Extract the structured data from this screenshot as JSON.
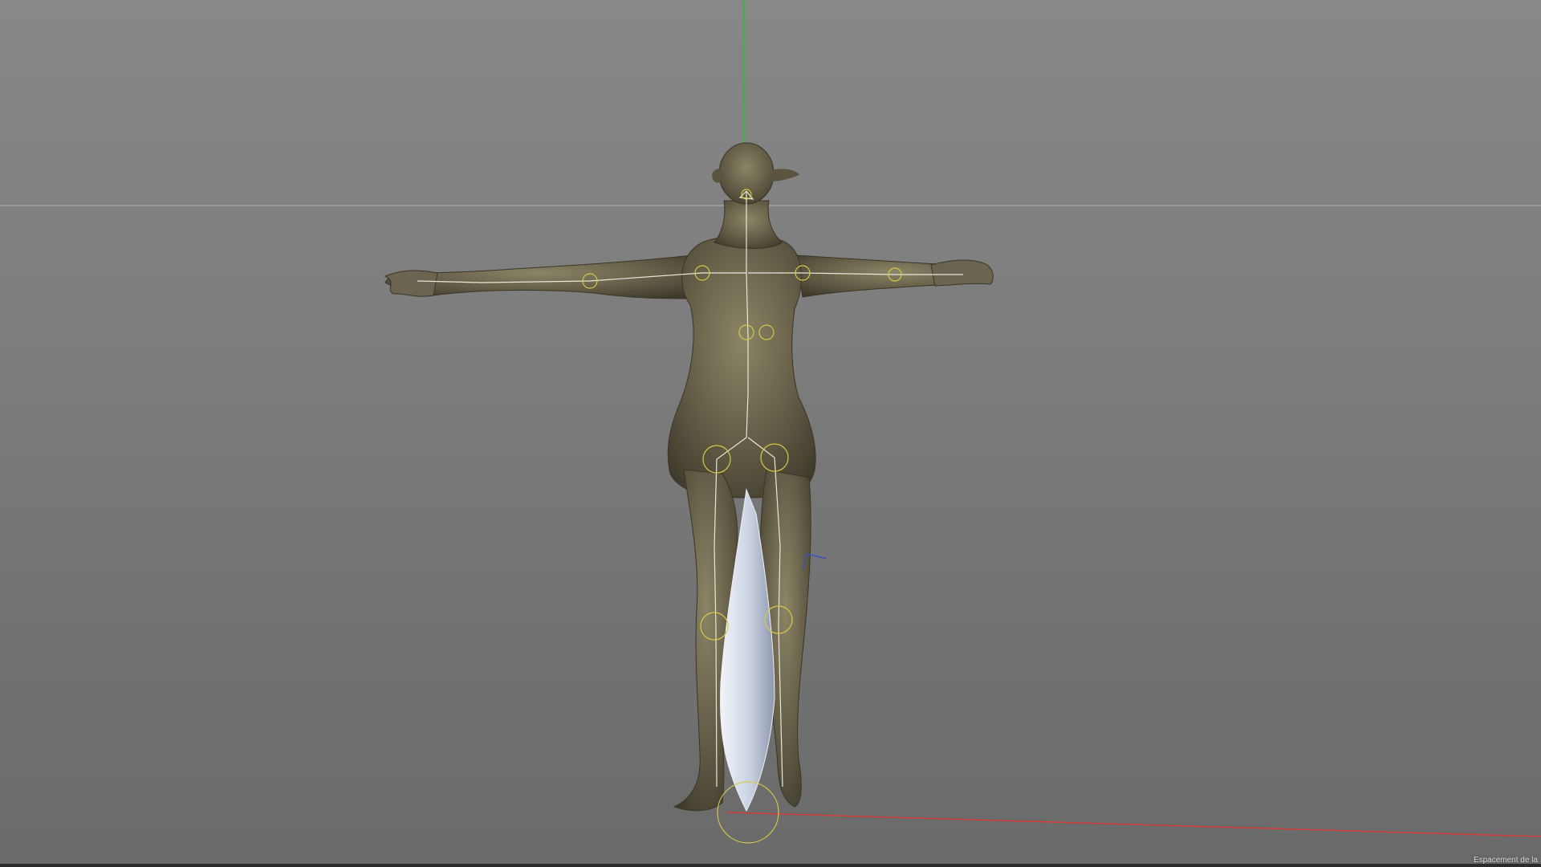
{
  "viewport": {
    "status_text": "Espacement de la",
    "colors": {
      "background_top": "#888888",
      "background_bottom": "#6a6a6a",
      "y_axis": "#2fbf2f",
      "x_axis": "#d23a3a",
      "horizon_line": "#a8a8a8",
      "skin": "#5f5a45",
      "skin_highlight": "#8a8566",
      "bone": "#e8e8d8",
      "joint": "#d8c84a",
      "blade": "#cfd6e6"
    },
    "icons": {
      "model": "character-mesh-icon",
      "skeleton": "joint-rig-icon"
    }
  }
}
